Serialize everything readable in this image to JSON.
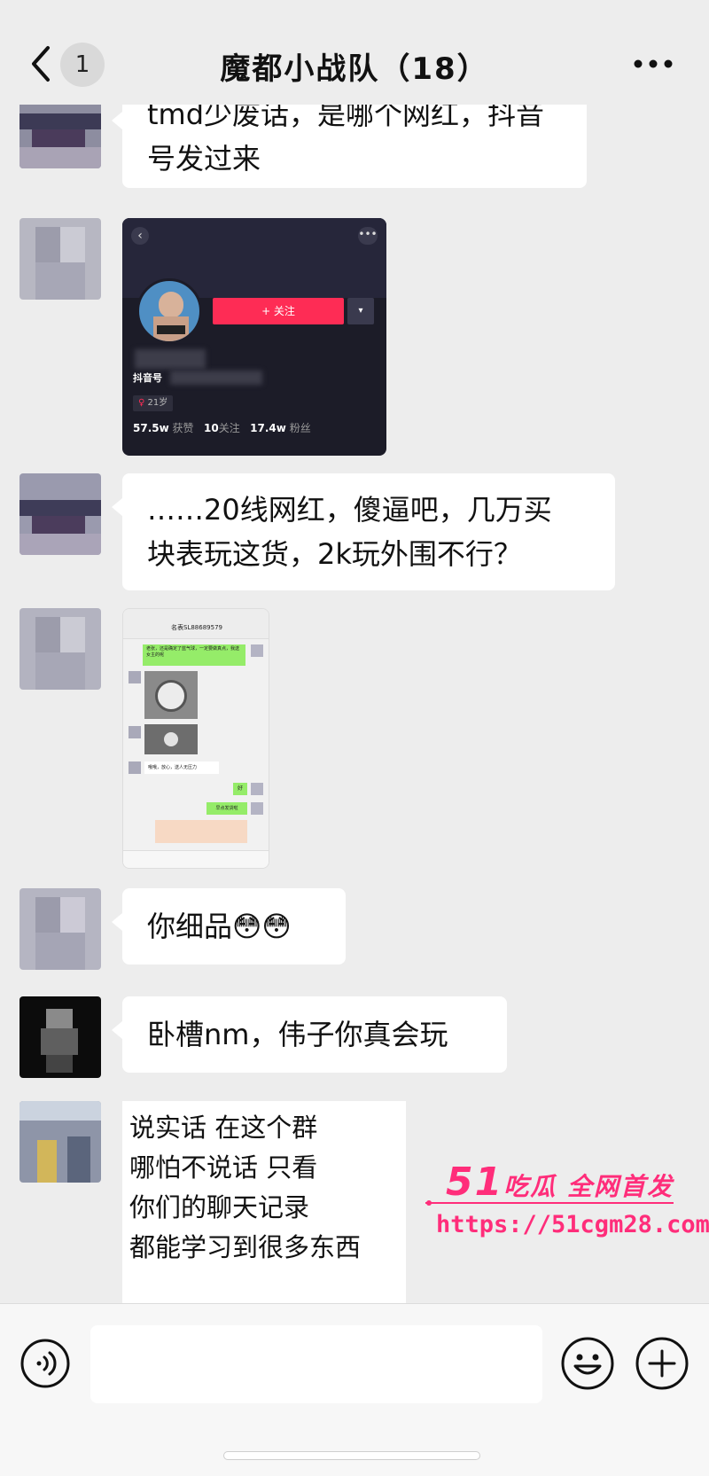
{
  "header": {
    "back_badge": "1",
    "title": "魔都小战队（18）"
  },
  "messages": [
    {
      "lines": [
        "tmd少废话，是哪个网红，抖音",
        "号发过来"
      ]
    },
    {
      "image": "profile-screenshot",
      "follow_label": "+ 关注",
      "platform_label": "抖音号",
      "age_label": "21岁",
      "likes": "57.5w",
      "likes_label": "获赞",
      "following": "10",
      "following_label": "关注",
      "followers": "17.4w",
      "followers_label": "粉丝"
    },
    {
      "lines": [
        "……20线网红，傻逼吧，几万买",
        "块表玩这货，2k玩外围不行？"
      ]
    },
    {
      "image": "chat-screenshot",
      "inner_title": "名表SL88689579",
      "inner_msg1": "老张，还是确定了蓝气球，一定要做真点，我送女主的呢",
      "inner_msg2": "哦哦，放心，送人无压力",
      "inner_msg3": "好",
      "inner_msg4": "早点发货啦"
    },
    {
      "lines": [
        "你细品"
      ],
      "emoji": [
        "😳",
        "😳"
      ]
    },
    {
      "lines": [
        "卧槽nm，伟子你真会玩"
      ]
    },
    {
      "lines": [
        "说实话 在这个群",
        "哪怕不说话 只看",
        "你们的聊天记录",
        "都能学习到很多东西"
      ]
    }
  ],
  "watermark": {
    "brand_num": "51",
    "brand_text": "吃瓜 全网首发",
    "url": "https://51cgm28.com"
  },
  "colors": {
    "background": "#ededed",
    "bubble": "#ffffff",
    "follow_button": "#fe2c55",
    "watermark": "#ff2d7a"
  },
  "icons": [
    "back-icon",
    "more-icon",
    "voice-icon",
    "emoji-icon",
    "plus-icon"
  ]
}
